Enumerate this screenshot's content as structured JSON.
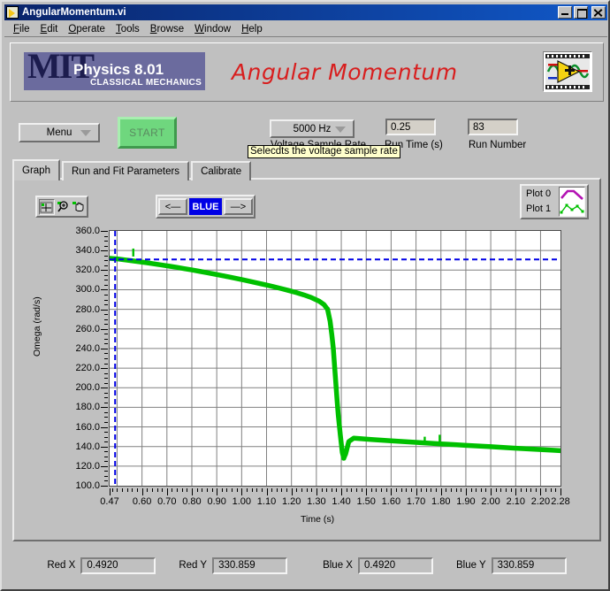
{
  "window": {
    "title": "AngularMomentum.vi",
    "icon": "labview-vi-icon",
    "minimize": "minimize-icon",
    "maximize": "maximize-icon",
    "close": "close-icon"
  },
  "menubar": {
    "items": [
      "File",
      "Edit",
      "Operate",
      "Tools",
      "Browse",
      "Window",
      "Help"
    ]
  },
  "header": {
    "logo_letters": "MIT",
    "logo_line1": "Physics 8.01",
    "logo_line2": "CLASSICAL MECHANICS",
    "title": "Angular Momentum",
    "ni_logo": "labview-logo-icon"
  },
  "controls": {
    "menu_button": "Menu",
    "start_button": "START",
    "sample_rate_value": "5000 Hz",
    "sample_rate_label": "Voltage Sample Rate",
    "run_time_value": "0.25",
    "run_time_label": "Run Time (s)",
    "run_number_value": "83",
    "run_number_label": "Run Number",
    "tooltip": "Selecdts the voltage sample rate"
  },
  "tabs": [
    {
      "label": "Graph",
      "active": true
    },
    {
      "label": "Run and Fit Parameters",
      "active": false
    },
    {
      "label": "Calibrate",
      "active": false
    }
  ],
  "graph_toolbar": {
    "cursor_tool": "crosshair-cursor-icon",
    "zoom_tool": "zoom-magnifier-icon",
    "pan_tool": "pan-hand-icon",
    "prev_button": "<—",
    "cursor_name": "BLUE",
    "next_button": "—>"
  },
  "legend": {
    "plot0_label": "Plot 0",
    "plot1_label": "Plot 1",
    "plot0_color": "#b312b3",
    "plot1_color": "#00c000"
  },
  "readouts": {
    "red_x_label": "Red X",
    "red_x_value": "0.4920",
    "red_y_label": "Red Y",
    "red_y_value": "330.859",
    "blue_x_label": "Blue X",
    "blue_x_value": "0.4920",
    "blue_y_label": "Blue Y",
    "blue_y_value": "330.859"
  },
  "chart_data": {
    "type": "line",
    "title": "",
    "xlabel": "Time (s)",
    "ylabel": "Omega (rad/s)",
    "xlim": [
      0.47,
      2.28
    ],
    "ylim": [
      100.0,
      360.0
    ],
    "grid": true,
    "legend_position": "top-right",
    "yticks": [
      "360.0",
      "340.0",
      "320.0",
      "300.0",
      "280.0",
      "260.0",
      "240.0",
      "220.0",
      "200.0",
      "180.0",
      "160.0",
      "140.0",
      "120.0",
      "100.0"
    ],
    "ytick_values": [
      360,
      340,
      320,
      300,
      280,
      260,
      240,
      220,
      200,
      180,
      160,
      140,
      120,
      100
    ],
    "xticks": [
      "0.47",
      "0.60",
      "0.70",
      "0.80",
      "0.90",
      "1.00",
      "1.10",
      "1.20",
      "1.30",
      "1.40",
      "1.50",
      "1.60",
      "1.70",
      "1.80",
      "1.90",
      "2.00",
      "2.10",
      "2.20",
      "2.28"
    ],
    "xtick_values": [
      0.47,
      0.6,
      0.7,
      0.8,
      0.9,
      1.0,
      1.1,
      1.2,
      1.3,
      1.4,
      1.5,
      1.6,
      1.7,
      1.8,
      1.9,
      2.0,
      2.1,
      2.2,
      2.28
    ],
    "cursors": {
      "blue": {
        "x": 0.492,
        "y": 330.859,
        "color": "#0000e6",
        "style": "dashed"
      }
    },
    "series": [
      {
        "name": "Plot 1",
        "color": "#00c000",
        "marker": "square",
        "x": [
          0.47,
          0.5,
          0.53,
          0.56,
          0.59,
          0.62,
          0.65,
          0.68,
          0.71,
          0.74,
          0.77,
          0.8,
          0.83,
          0.86,
          0.89,
          0.92,
          0.95,
          0.98,
          1.01,
          1.04,
          1.07,
          1.1,
          1.13,
          1.16,
          1.19,
          1.22,
          1.25,
          1.28,
          1.31,
          1.33,
          1.345,
          1.355,
          1.362,
          1.368,
          1.372,
          1.376,
          1.38,
          1.384,
          1.388,
          1.392,
          1.396,
          1.4,
          1.404,
          1.41,
          1.418,
          1.43,
          1.45,
          1.48,
          1.52,
          1.56,
          1.6,
          1.65,
          1.7,
          1.75,
          1.8,
          1.85,
          1.9,
          1.95,
          2.0,
          2.05,
          2.1,
          2.15,
          2.2,
          2.25,
          2.28
        ],
        "y": [
          332.0,
          331.5,
          330.5,
          329.5,
          328.5,
          327.5,
          326.3,
          325.2,
          324.0,
          322.8,
          321.5,
          320.2,
          318.8,
          317.4,
          316.0,
          314.5,
          313.0,
          311.4,
          309.8,
          308.2,
          306.5,
          304.8,
          303.0,
          301.1,
          299.1,
          297.0,
          294.7,
          292.0,
          288.5,
          285.0,
          280.0,
          268.0,
          254.0,
          240.0,
          226.0,
          212.0,
          198.0,
          184.0,
          172.0,
          162.0,
          152.0,
          143.0,
          134.0,
          128.0,
          133.0,
          145.0,
          148.5,
          148.0,
          147.2,
          146.5,
          145.8,
          145.0,
          144.2,
          143.4,
          142.7,
          142.0,
          141.2,
          140.5,
          139.8,
          139.0,
          138.3,
          137.6,
          136.9,
          136.2,
          135.8
        ]
      }
    ],
    "description": "Angular velocity decays slowly from ~332 rad/s, then drops sharply near t=1.37 s to ~130 rad/s, recovers to ~148 rad/s and decays slowly to ~136 rad/s."
  }
}
